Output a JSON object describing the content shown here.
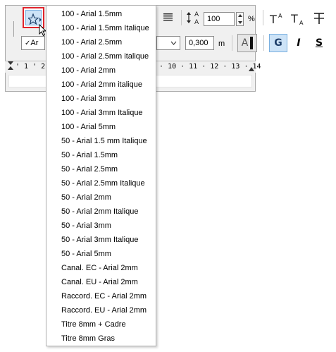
{
  "toolbar": {
    "favorites_icon": "star-arrow-icon",
    "paragraph_icon": "align-justify-icon",
    "line_spacing_icon": "line-spacing-icon",
    "line_spacing_value": "100",
    "line_spacing_unit": "%",
    "superscript_icon": "superscript-icon",
    "subscript_icon": "subscript-icon",
    "strikethrough_icon": "strikethrough-icon",
    "font_combo_value": "Ar",
    "size_value": "0,300",
    "size_unit": "m",
    "text_color_label": "A",
    "bold_label": "G",
    "italic_label": "I",
    "underline_label": "S"
  },
  "ruler": {
    "left_tick": "1",
    "left_tick_2": "2",
    "right_ticks": "9 · 10 · 11 · 12 · 13 · 14"
  },
  "favorites_menu": {
    "items": [
      "100 - Arial 1.5mm",
      "100 - Arial 1.5mm Italique",
      "100 - Arial 2.5mm",
      "100 - Arial 2.5mm italique",
      "100 - Arial 2mm",
      "100 - Arial 2mm italique",
      "100 - Arial 3mm",
      "100 - Arial 3mm Italique",
      "100 - Arial 5mm",
      "50 - Arial 1.5 mm Italique",
      "50 - Arial 1.5mm",
      "50 - Arial 2.5mm",
      "50 - Arial 2.5mm Italique",
      "50 - Arial 2mm",
      "50 - Arial 2mm Italique",
      "50 - Arial 3mm",
      "50 - Arial 3mm Italique",
      "50 - Arial 5mm",
      "Canal. EC - Arial 2mm",
      "Canal. EU - Arial 2mm",
      "Raccord. EC - Arial 2mm",
      "Raccord. EU - Arial 2mm",
      "Titre 8mm + Cadre",
      "Titre 8mm Gras"
    ]
  }
}
